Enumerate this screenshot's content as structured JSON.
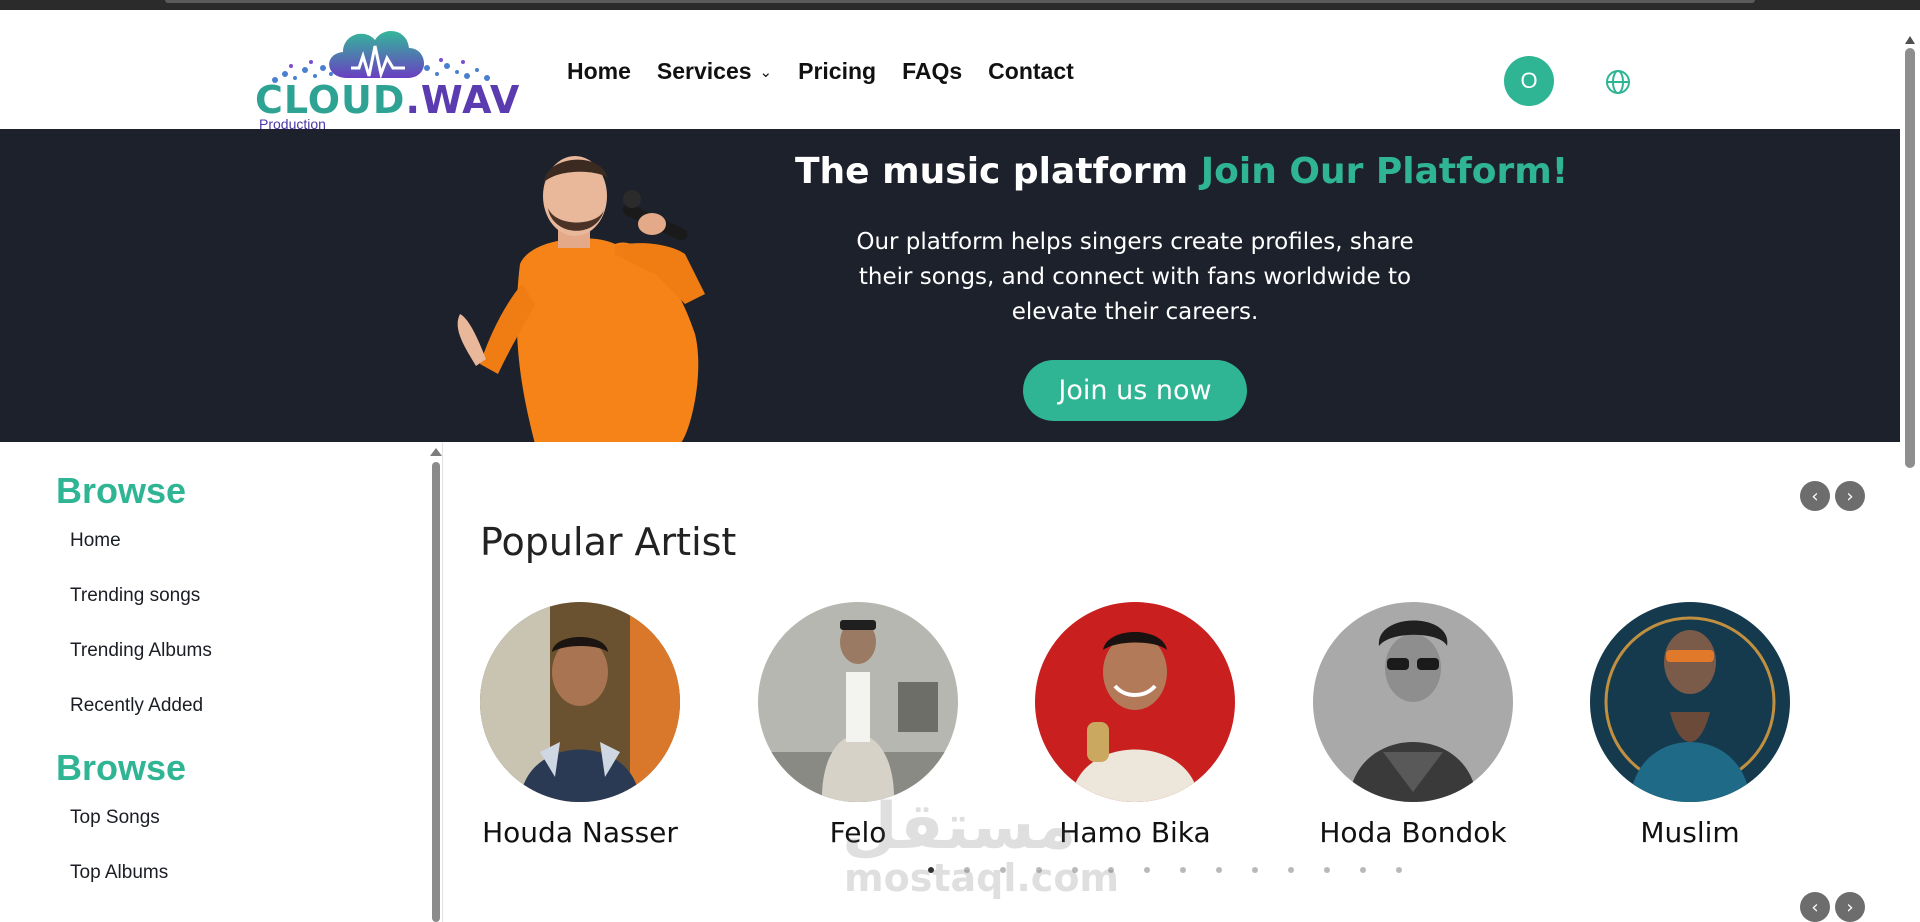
{
  "colors": {
    "accent": "#2fb594",
    "hero_bg": "#1d212c",
    "text": "#1b1e24"
  },
  "logo": {
    "name": "CLOUD",
    "name2": ".WAV",
    "tagline": "Production"
  },
  "nav": [
    {
      "label": "Home"
    },
    {
      "label": "Services",
      "has_dropdown": true
    },
    {
      "label": "Pricing"
    },
    {
      "label": "FAQs"
    },
    {
      "label": "Contact"
    }
  ],
  "user": {
    "avatar_initial": "O"
  },
  "language_icon": "globe-icon",
  "hero": {
    "title_white": "The music platform",
    "title_accent": "Join Our Platform!",
    "description": "Our platform helps singers create profiles, share their songs, and connect with fans worldwide to elevate their careers.",
    "cta": "Join us now"
  },
  "sidebar": {
    "section1": {
      "heading": "Browse",
      "links": [
        "Home",
        "Trending songs",
        "Trending Albums",
        "Recently Added"
      ]
    },
    "section2": {
      "heading": "Browse",
      "links": [
        "Top Songs",
        "Top Albums"
      ]
    }
  },
  "popular": {
    "title": "Popular Artist",
    "artists": [
      {
        "name": "Houda Nasser"
      },
      {
        "name": "Felo"
      },
      {
        "name": "Hamo Bika"
      },
      {
        "name": "Hoda Bondok"
      },
      {
        "name": "Muslim"
      }
    ],
    "pagination_total": 14,
    "pagination_active": 1
  },
  "carousel_controls": {
    "prev_icon": "chevron-left-icon",
    "next_icon": "chevron-right-icon"
  },
  "watermark": {
    "arabic": "مستقل",
    "latin": "mostaql.com"
  }
}
